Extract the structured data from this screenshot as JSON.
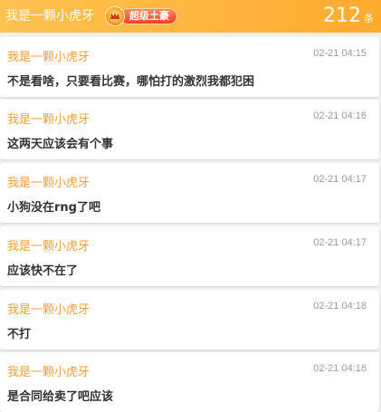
{
  "header": {
    "name": "我是一颗小虎牙",
    "badge_label": "超级土豪",
    "count": "212",
    "count_unit": "条"
  },
  "messages": [
    {
      "user": "我是一颗小虎牙",
      "time": "02-21 04:15",
      "text": "不是看啥，只要看比赛，哪怕打的激烈我都犯困"
    },
    {
      "user": "我是一颗小虎牙",
      "time": "02-21 04:16",
      "text": "这两天应该会有个事"
    },
    {
      "user": "我是一颗小虎牙",
      "time": "02-21 04:17",
      "text": "小狗没在rng了吧"
    },
    {
      "user": "我是一颗小虎牙",
      "time": "02-21 04:17",
      "text": "应该快不在了"
    },
    {
      "user": "我是一颗小虎牙",
      "time": "02-21 04:18",
      "text": "不打"
    },
    {
      "user": "我是一颗小虎牙",
      "time": "02-21 04:18",
      "text": "是合同给卖了吧应该"
    }
  ],
  "colors": {
    "header_gradient_start": "#fec24f",
    "header_gradient_end": "#feab2f",
    "username": "#f5a03a",
    "badge": "#f0402c"
  },
  "icons": {
    "badge": "crown-medal-icon"
  }
}
